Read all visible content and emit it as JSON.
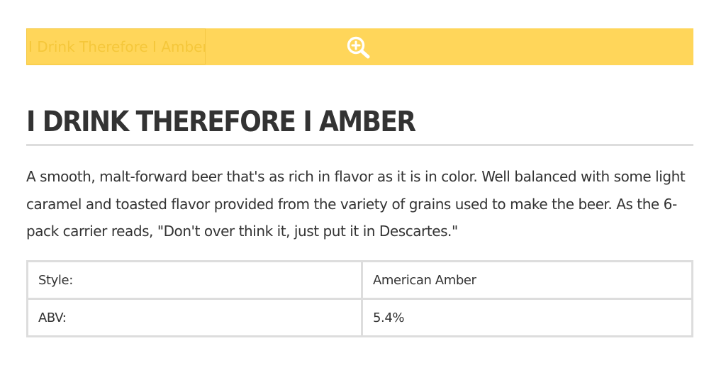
{
  "image": {
    "alt_text": "I Drink Therefore I Amber",
    "zoom_icon": "zoom-in-icon",
    "background_color": "#ffd65a"
  },
  "beer": {
    "title": "I DRINK THEREFORE I AMBER",
    "description": "A smooth, malt-forward beer that's as rich in flavor as it is in color. Well balanced with some light caramel and toasted flavor provided from the variety of grains used to make the beer. As the 6-pack carrier reads, \"Don't over think it, just put it in Descartes.\""
  },
  "specs": [
    {
      "label": "Style:",
      "value": "American Amber"
    },
    {
      "label": "ABV:",
      "value": "5.4%"
    }
  ]
}
